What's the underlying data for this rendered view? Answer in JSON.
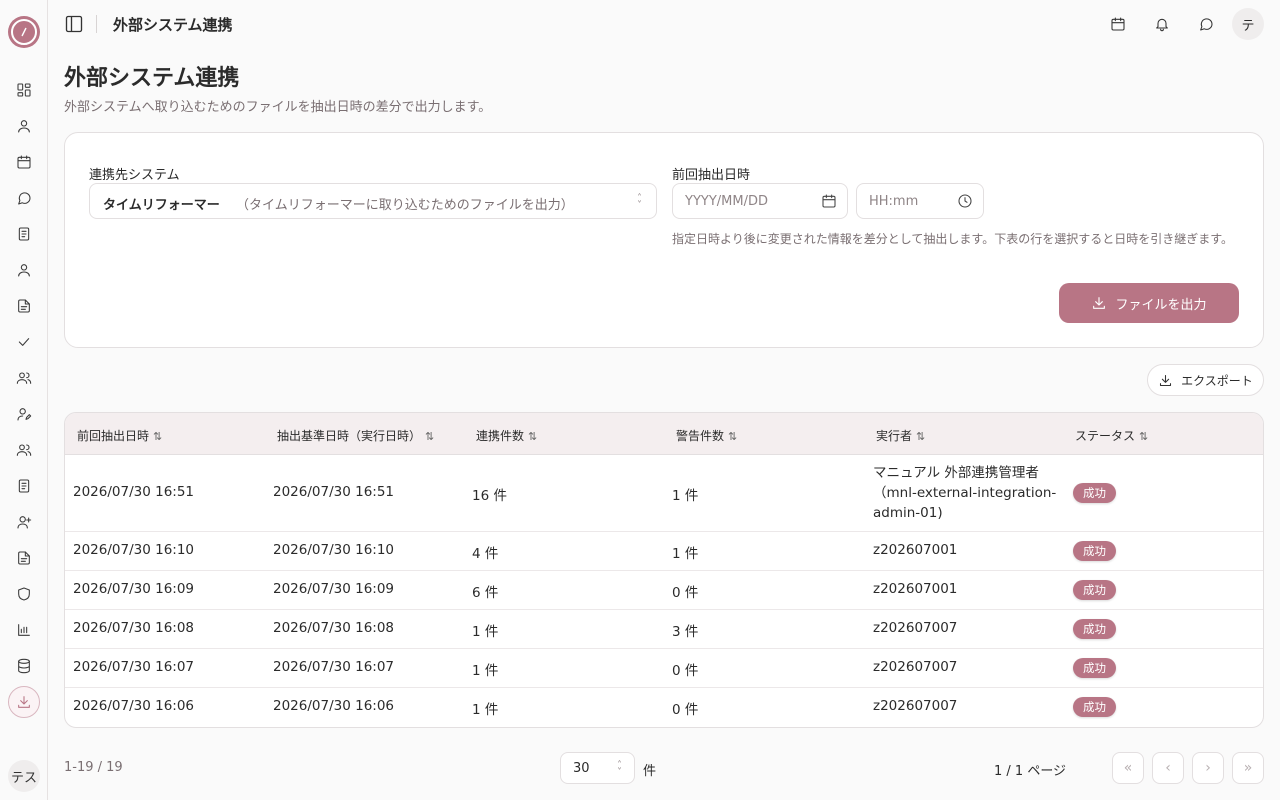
{
  "header": {
    "title": "外部システム連携",
    "avatar_label": "テ"
  },
  "sidebar": {
    "user_label": "テス"
  },
  "page": {
    "title": "外部システム連携",
    "description": "外部システムへ取り込むためのファイルを抽出日時の差分で出力します。"
  },
  "form": {
    "system_label": "連携先システム",
    "system_value": "タイムリフォーマー",
    "system_description": "（タイムリフォーマーに取り込むためのファイルを出力）",
    "last_extract_label": "前回抽出日時",
    "date_placeholder": "YYYY/MM/DD",
    "time_placeholder": "HH:mm",
    "hint": "指定日時より後に変更された情報を差分として抽出します。下表の行を選択すると日時を引き継ぎます。",
    "submit_label": "ファイルを出力"
  },
  "toolbar": {
    "export_label": "エクスポート"
  },
  "table": {
    "sort_glyph": "⇅",
    "headers": [
      "前回抽出日時",
      "抽出基準日時（実行日時）",
      "連携件数",
      "警告件数",
      "実行者",
      "ステータス"
    ],
    "rows": [
      {
        "prev": "2026/07/30 16:51",
        "base": "2026/07/30 16:51",
        "count": "16 件",
        "warn": "1 件",
        "executor": "マニュアル 外部連携管理者（mnl-external-integration-admin-01)",
        "status": "成功"
      },
      {
        "prev": "2026/07/30 16:10",
        "base": "2026/07/30 16:10",
        "count": "4 件",
        "warn": "1 件",
        "executor": "z202607001",
        "status": "成功"
      },
      {
        "prev": "2026/07/30 16:09",
        "base": "2026/07/30 16:09",
        "count": "6 件",
        "warn": "0 件",
        "executor": "z202607001",
        "status": "成功"
      },
      {
        "prev": "2026/07/30 16:08",
        "base": "2026/07/30 16:08",
        "count": "1 件",
        "warn": "3 件",
        "executor": "z202607007",
        "status": "成功"
      },
      {
        "prev": "2026/07/30 16:07",
        "base": "2026/07/30 16:07",
        "count": "1 件",
        "warn": "0 件",
        "executor": "z202607007",
        "status": "成功"
      },
      {
        "prev": "2026/07/30 16:06",
        "base": "2026/07/30 16:06",
        "count": "1 件",
        "warn": "0 件",
        "executor": "z202607007",
        "status": "成功"
      }
    ]
  },
  "pagination": {
    "range": "1-19 / 19",
    "per_page": "30",
    "per_page_unit": "件",
    "page_info": "1 / 1 ページ",
    "first": "«",
    "prev": "‹",
    "next": "›",
    "last": "»"
  },
  "colors": {
    "accent": "#b87585",
    "header_bg": "#f4eeef"
  }
}
